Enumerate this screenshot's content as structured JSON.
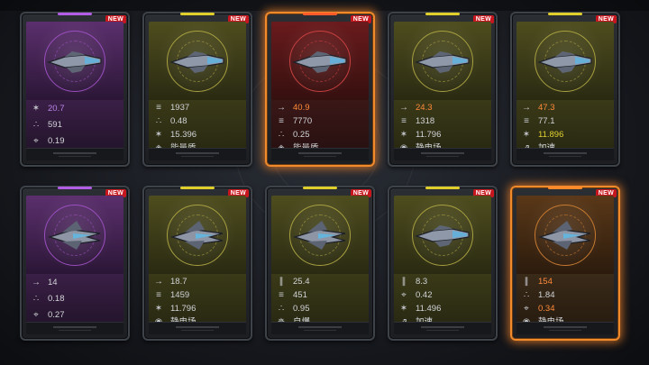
{
  "badge_text": "NEW",
  "stat_icons": {
    "speed": "arrow-right-icon",
    "fire_rate": "fire-rate-icon",
    "spread": "triple-dot-icon",
    "accuracy": "crosshair-icon",
    "damage": "damage-burst-icon",
    "ammo": "ammo-icon",
    "shield": "shield-icon",
    "static": "static-field-icon",
    "self_destruct": "gear-burst-icon",
    "accelerate": "accelerate-icon"
  },
  "cards": [
    {
      "rarity": "purple",
      "selected": false,
      "stats": [
        {
          "icon": "damage",
          "value": "20.7",
          "color": "purple"
        },
        {
          "icon": "spread",
          "value": "591"
        },
        {
          "icon": "accuracy",
          "value": "0.19"
        }
      ]
    },
    {
      "rarity": "yellow",
      "selected": false,
      "stats": [
        {
          "icon": "fire_rate",
          "value": "1937"
        },
        {
          "icon": "spread",
          "value": "0.48"
        },
        {
          "icon": "damage",
          "value": "15.396"
        },
        {
          "icon": "shield",
          "value": "能量盾"
        }
      ]
    },
    {
      "rarity": "red",
      "selected": true,
      "stats": [
        {
          "icon": "speed",
          "value": "40.9",
          "color": "orange"
        },
        {
          "icon": "fire_rate",
          "value": "7770"
        },
        {
          "icon": "spread",
          "value": "0.25"
        },
        {
          "icon": "shield",
          "value": "能量盾"
        }
      ]
    },
    {
      "rarity": "yellow",
      "selected": false,
      "stats": [
        {
          "icon": "speed",
          "value": "24.3",
          "color": "orange"
        },
        {
          "icon": "fire_rate",
          "value": "1318"
        },
        {
          "icon": "damage",
          "value": "11.796"
        },
        {
          "icon": "static",
          "value": "静电场"
        }
      ]
    },
    {
      "rarity": "yellow",
      "selected": false,
      "stats": [
        {
          "icon": "speed",
          "value": "47.3",
          "color": "orange"
        },
        {
          "icon": "fire_rate",
          "value": "77.1"
        },
        {
          "icon": "damage",
          "value": "11.896",
          "color": "yellow"
        },
        {
          "icon": "accelerate",
          "value": "加速"
        }
      ]
    },
    {
      "rarity": "purple",
      "selected": false,
      "stats": [
        {
          "icon": "speed",
          "value": "14"
        },
        {
          "icon": "spread",
          "value": "0.18"
        },
        {
          "icon": "accuracy",
          "value": "0.27"
        }
      ]
    },
    {
      "rarity": "yellow",
      "selected": false,
      "stats": [
        {
          "icon": "speed",
          "value": "18.7"
        },
        {
          "icon": "fire_rate",
          "value": "1459"
        },
        {
          "icon": "damage",
          "value": "11.796"
        },
        {
          "icon": "static",
          "value": "静电场"
        }
      ]
    },
    {
      "rarity": "yellow",
      "selected": false,
      "stats": [
        {
          "icon": "ammo",
          "value": "25.4"
        },
        {
          "icon": "fire_rate",
          "value": "451"
        },
        {
          "icon": "spread",
          "value": "0.95"
        },
        {
          "icon": "self_destruct",
          "value": "自爆"
        }
      ]
    },
    {
      "rarity": "yellow",
      "selected": false,
      "stats": [
        {
          "icon": "ammo",
          "value": "8.3"
        },
        {
          "icon": "accuracy",
          "value": "0.42"
        },
        {
          "icon": "damage",
          "value": "11.496"
        },
        {
          "icon": "accelerate",
          "value": "加速"
        }
      ]
    },
    {
      "rarity": "orange",
      "selected": true,
      "stats": [
        {
          "icon": "ammo",
          "value": "154",
          "color": "orange"
        },
        {
          "icon": "spread",
          "value": "1.84"
        },
        {
          "icon": "accuracy",
          "value": "0.34",
          "color": "orange"
        },
        {
          "icon": "static",
          "value": "静电场"
        }
      ]
    }
  ],
  "colors": {
    "purple": {
      "c1": "#5b2f6d",
      "c2": "#2b1636",
      "ring": "#9a4fbf",
      "bar": "#b35ce6",
      "s1": "#3a1f46",
      "s2": "#23142b"
    },
    "yellow": {
      "c1": "#4e4d1e",
      "c2": "#2a2a12",
      "ring": "#a8a040",
      "bar": "#e0cf2a",
      "s1": "#3a3a18",
      "s2": "#262612"
    },
    "red": {
      "c1": "#6a1a1c",
      "c2": "#35100f",
      "ring": "#c84040",
      "bar": "#ff5a2a",
      "s1": "#3a1717",
      "s2": "#261010"
    },
    "orange": {
      "c1": "#5a3818",
      "c2": "#2c1b0d",
      "ring": "#c77a30",
      "bar": "#ff8a2a",
      "s1": "#3a2a18",
      "s2": "#241a0f"
    }
  }
}
